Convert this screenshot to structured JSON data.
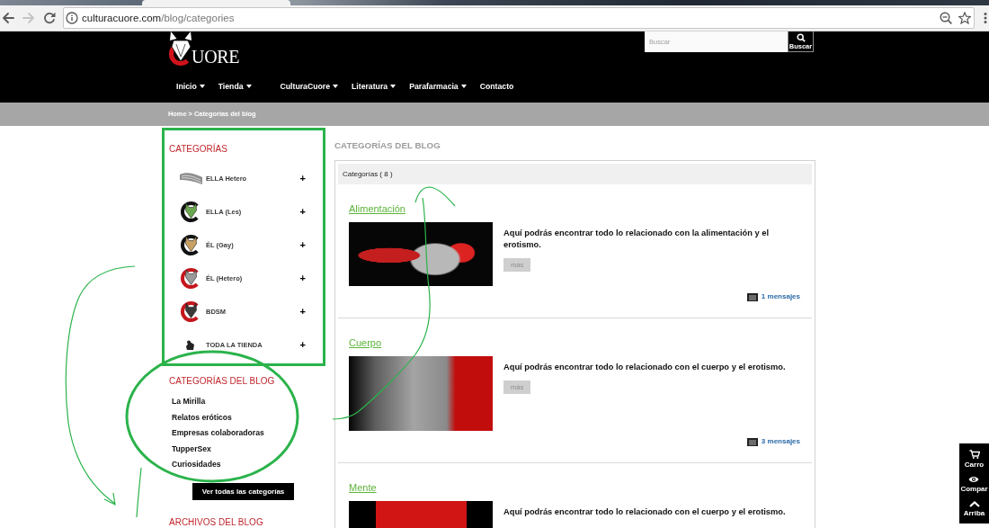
{
  "browser": {
    "url_host": "culturacuore.com",
    "url_path": "/blog/categories",
    "back_enabled": true,
    "forward_enabled": false
  },
  "header": {
    "logo_text": "UORE",
    "search": {
      "placeholder": "Buscar",
      "button": "Buscar"
    },
    "nav": [
      {
        "label": "Inicio",
        "dropdown": true
      },
      {
        "label": "Tienda",
        "dropdown": true
      },
      {
        "label": "CulturaCuore",
        "dropdown": true
      },
      {
        "label": "Literatura",
        "dropdown": true
      },
      {
        "label": "Parafarmacia",
        "dropdown": true
      },
      {
        "label": "Contacto",
        "dropdown": false
      }
    ]
  },
  "breadcrumb": "Home > Categorías del blog",
  "sidebar": {
    "categories": {
      "title": "CATEGORÍAS",
      "items": [
        {
          "label": "ELLA Hetero",
          "toggle": "+"
        },
        {
          "label": "ELLA (Les)",
          "toggle": "+"
        },
        {
          "label": "ÉL (Gay)",
          "toggle": "+"
        },
        {
          "label": "ÉL (Hetero)",
          "toggle": "+"
        },
        {
          "label": "BDSM",
          "toggle": "+"
        },
        {
          "label": "TODA LA TIENDA",
          "toggle": "+"
        }
      ]
    },
    "blog_categories": {
      "title": "CATEGORÍAS DEL BLOG",
      "links": [
        "La Mirilla",
        "Relatos eróticos",
        "Empresas colaboradoras",
        "TupperSex",
        "Curiosidades"
      ],
      "button": "Ver todas las categorías"
    },
    "archive": {
      "title": "ARCHIVOS DEL BLOG"
    }
  },
  "main": {
    "title": "CATEGORÍAS DEL BLOG",
    "panel_header": "Categorías ( 8 )",
    "cards": [
      {
        "title": "Alimentación",
        "description": "Aquí podrás encontrar todo lo relacionado con la alimentación y el erotismo.",
        "more": "más",
        "messages": "1 mensajes"
      },
      {
        "title": "Cuerpo",
        "description": "Aquí podrás encontrar todo lo relacionado con el cuerpo y el erotismo.",
        "more": "más",
        "messages": "3 mensajes"
      },
      {
        "title": "Mente",
        "description": "Aquí podrás encontrar todo lo relacionado con el cuerpo y el erotismo."
      }
    ]
  },
  "floating_toolbar": [
    {
      "kind": "cart",
      "label": "Carro"
    },
    {
      "kind": "eye",
      "label": "Compar"
    },
    {
      "kind": "up",
      "label": "Arriba"
    }
  ]
}
